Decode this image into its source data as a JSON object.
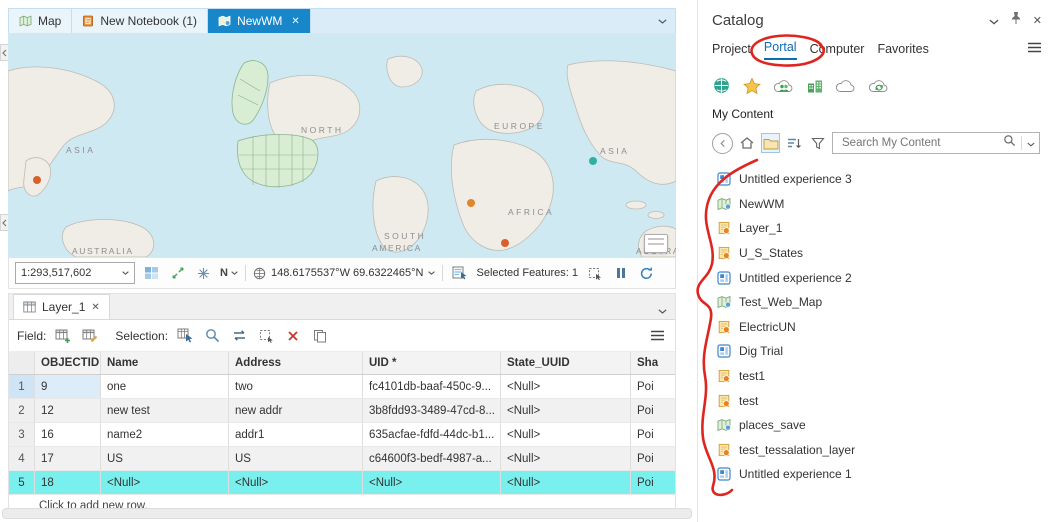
{
  "view_tabs": [
    {
      "label": "Map"
    },
    {
      "label": "New Notebook (1)"
    },
    {
      "label": "NewWM"
    }
  ],
  "map": {
    "scale": "1:293,517,602",
    "coordinates": "148.6175537°W 69.6322465°N",
    "selected_features": "Selected Features: 1",
    "labels": {
      "asia_w": "ASIA",
      "north": "NORTH",
      "europe": "EUROPE",
      "asia_e": "ASIA",
      "africa": "AFRICA",
      "south": "SOUTH",
      "america": "AMERICA",
      "australia_w": "AUSTRALIA",
      "australia_e": "AUSTRAL"
    }
  },
  "table": {
    "tab_label": "Layer_1",
    "field_label": "Field:",
    "selection_label": "Selection:",
    "columns": [
      "OBJECTID *",
      "Name",
      "Address",
      "UID *",
      "State_UUID",
      "Sha"
    ],
    "rows": [
      {
        "n": "1",
        "cells": [
          "9",
          "one",
          "two",
          "fc4101db-baaf-450c-9...",
          "<Null>",
          "Poi"
        ]
      },
      {
        "n": "2",
        "cells": [
          "12",
          "new test",
          "new addr",
          "3b8fdd93-3489-47cd-8...",
          "<Null>",
          "Poi"
        ]
      },
      {
        "n": "3",
        "cells": [
          "16",
          "name2",
          "addr1",
          "635acfae-fdfd-44dc-b1...",
          "<Null>",
          "Poi"
        ]
      },
      {
        "n": "4",
        "cells": [
          "17",
          "US",
          "US",
          "c64600f3-bedf-4987-a...",
          "<Null>",
          "Poi"
        ]
      },
      {
        "n": "5",
        "cells": [
          "18",
          "<Null>",
          "<Null>",
          "<Null>",
          "<Null>",
          "Poi"
        ]
      }
    ],
    "add_row_label": "Click to add new row."
  },
  "catalog": {
    "title": "Catalog",
    "tabs": [
      "Project",
      "Portal",
      "Computer",
      "Favorites"
    ],
    "my_content_label": "My Content",
    "search_placeholder": "Search My Content",
    "items": [
      {
        "label": "Untitled experience 3",
        "type": "experience"
      },
      {
        "label": "NewWM",
        "type": "webmap"
      },
      {
        "label": "Layer_1",
        "type": "layer"
      },
      {
        "label": "U_S_States",
        "type": "layer"
      },
      {
        "label": "Untitled experience 2",
        "type": "experience"
      },
      {
        "label": "Test_Web_Map",
        "type": "webmap"
      },
      {
        "label": "ElectricUN",
        "type": "layer"
      },
      {
        "label": "Dig Trial",
        "type": "experience"
      },
      {
        "label": "test1",
        "type": "layer"
      },
      {
        "label": "test",
        "type": "layer"
      },
      {
        "label": "places_save",
        "type": "webmap"
      },
      {
        "label": "test_tessalation_layer",
        "type": "layer"
      },
      {
        "label": "Untitled experience 1",
        "type": "experience"
      }
    ]
  }
}
